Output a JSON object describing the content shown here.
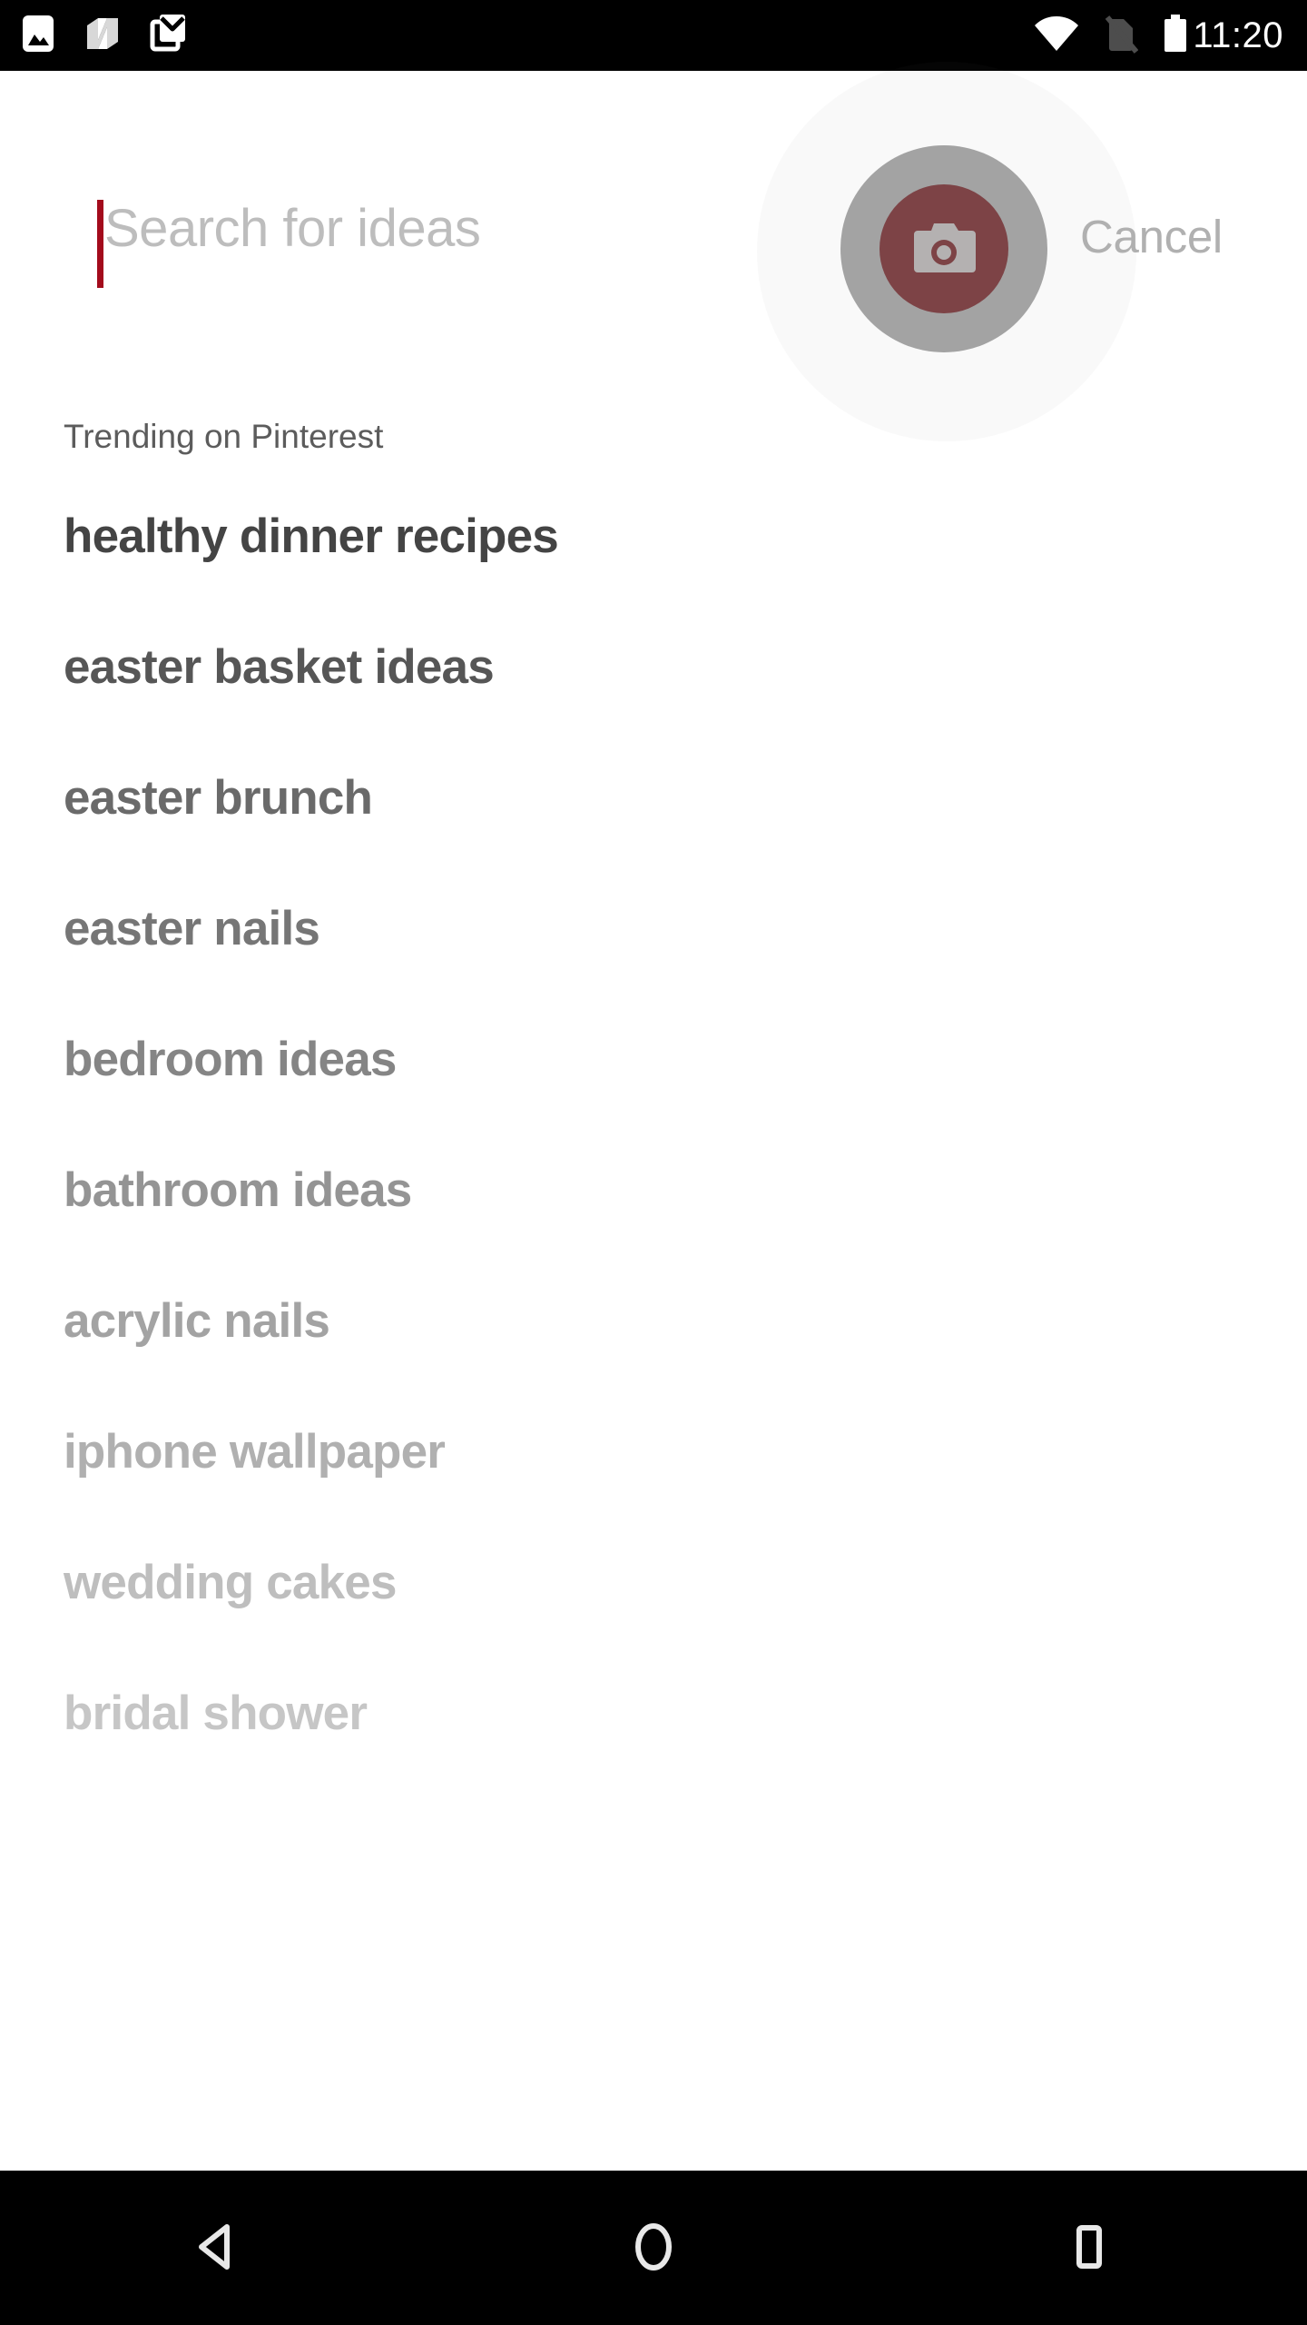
{
  "status_bar": {
    "background": "#000000",
    "clock": "11:20",
    "left_icons": [
      {
        "name": "screenshot-icon",
        "label": "Screenshot"
      },
      {
        "name": "nova-launcher-icon",
        "label": "N"
      },
      {
        "name": "gmail-icon",
        "label": "Gmail"
      }
    ],
    "right_icons": [
      {
        "name": "wifi-icon",
        "label": "Wi-Fi"
      },
      {
        "name": "no-sim-icon",
        "label": "No SIM"
      },
      {
        "name": "battery-icon",
        "label": "Battery"
      }
    ]
  },
  "search": {
    "value": "",
    "placeholder": "Search for ideas",
    "placeholder_color": "#bdbdbd",
    "caret_color": "#a30b1c",
    "camera_button_label": "Visual search",
    "camera_ring_color": "#6e6e6e",
    "camera_inner_color": "#7d4346",
    "cancel_label": "Cancel",
    "cancel_color": "#b0b0b0"
  },
  "trending": {
    "heading": "Trending on Pinterest",
    "heading_color": "#5c5c5c",
    "items": [
      {
        "label": "healthy dinner recipes",
        "color": "#444444"
      },
      {
        "label": "easter basket ideas",
        "color": "#565656"
      },
      {
        "label": "easter brunch",
        "color": "#6a6a6a"
      },
      {
        "label": "easter nails",
        "color": "#767676"
      },
      {
        "label": "bedroom ideas",
        "color": "#858585"
      },
      {
        "label": "bathroom ideas",
        "color": "#949494"
      },
      {
        "label": "acrylic nails",
        "color": "#a3a3a3"
      },
      {
        "label": "iphone wallpaper",
        "color": "#b0b0b0"
      },
      {
        "label": "wedding cakes",
        "color": "#bebebe"
      },
      {
        "label": "bridal shower",
        "color": "#c6c6c6"
      }
    ]
  },
  "nav_bar": {
    "background": "#000000",
    "buttons": [
      {
        "name": "back-button",
        "label": "Back"
      },
      {
        "name": "home-button",
        "label": "Home"
      },
      {
        "name": "recents-button",
        "label": "Recents"
      }
    ]
  }
}
